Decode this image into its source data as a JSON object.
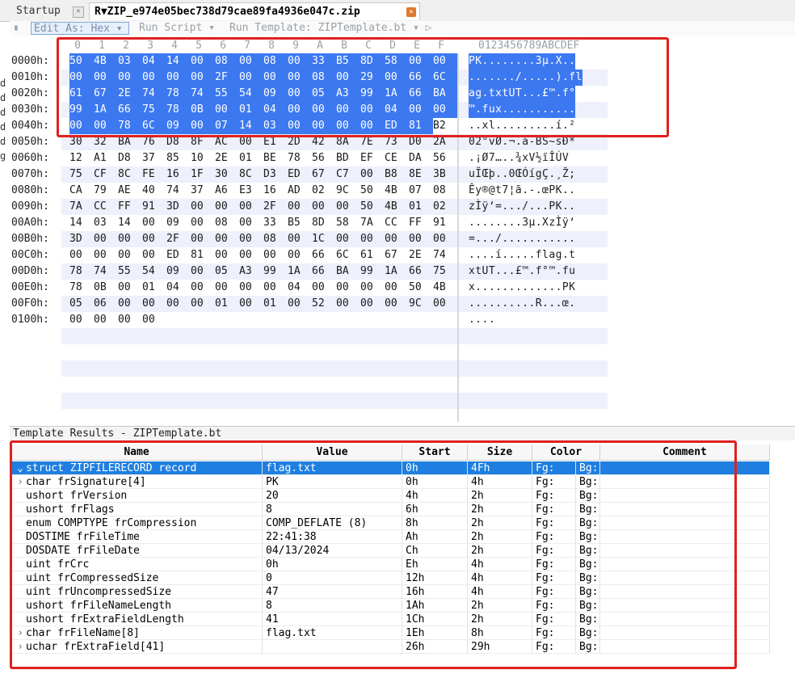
{
  "tabs": {
    "startup": "Startup",
    "file": "R▼ZIP_e974e05bec738d79cae89fa4936e047c.zip"
  },
  "toolbar": {
    "edit_as": "Edit As: Hex ▾",
    "run_script": "Run Script ▾",
    "run_template": "Run Template: ZIPTemplate.bt ▾ ▷"
  },
  "hex": {
    "col_headers": [
      "0",
      "1",
      "2",
      "3",
      "4",
      "5",
      "6",
      "7",
      "8",
      "9",
      "A",
      "B",
      "C",
      "D",
      "E",
      "F"
    ],
    "ascii_header": "0123456789ABCDEF",
    "rows": [
      {
        "addr": "0000h:",
        "bytes": [
          "50",
          "4B",
          "03",
          "04",
          "14",
          "00",
          "08",
          "00",
          "08",
          "00",
          "33",
          "B5",
          "8D",
          "58",
          "00",
          "00"
        ],
        "ascii": "PK........3µ.X.."
      },
      {
        "addr": "0010h:",
        "bytes": [
          "00",
          "00",
          "00",
          "00",
          "00",
          "00",
          "2F",
          "00",
          "00",
          "00",
          "08",
          "00",
          "29",
          "00",
          "66",
          "6C"
        ],
        "ascii": "......./.....).fl"
      },
      {
        "addr": "0020h:",
        "bytes": [
          "61",
          "67",
          "2E",
          "74",
          "78",
          "74",
          "55",
          "54",
          "09",
          "00",
          "05",
          "A3",
          "99",
          "1A",
          "66",
          "BA"
        ],
        "ascii": "ag.txtUT...£™.f°"
      },
      {
        "addr": "0030h:",
        "bytes": [
          "99",
          "1A",
          "66",
          "75",
          "78",
          "0B",
          "00",
          "01",
          "04",
          "00",
          "00",
          "00",
          "00",
          "04",
          "00",
          "00"
        ],
        "ascii": "™.fux..........."
      },
      {
        "addr": "0040h:",
        "bytes": [
          "00",
          "00",
          "78",
          "6C",
          "09",
          "00",
          "07",
          "14",
          "03",
          "00",
          "00",
          "00",
          "00",
          "ED",
          "81",
          "B2"
        ],
        "ascii": "..xl.........í.²"
      },
      {
        "addr": "0050h:",
        "bytes": [
          "30",
          "32",
          "BA",
          "76",
          "D8",
          "8F",
          "AC",
          "00",
          "E1",
          "2D",
          "42",
          "8A",
          "7E",
          "73",
          "D0",
          "2A"
        ],
        "ascii": "02°vØ.¬.á-BS~sÐ*"
      },
      {
        "addr": "0060h:",
        "bytes": [
          "12",
          "A1",
          "D8",
          "37",
          "85",
          "10",
          "2E",
          "01",
          "BE",
          "78",
          "56",
          "BD",
          "EF",
          "CE",
          "DA",
          "56"
        ],
        "ascii": ".¡Ø7…..¾xV½ïÎÚV"
      },
      {
        "addr": "0070h:",
        "bytes": [
          "75",
          "CF",
          "8C",
          "FE",
          "16",
          "1F",
          "30",
          "8C",
          "D3",
          "ED",
          "67",
          "C7",
          "00",
          "B8",
          "8E",
          "3B"
        ],
        "ascii": "uÏŒþ..0ŒÓígÇ.¸Ž;"
      },
      {
        "addr": "0080h:",
        "bytes": [
          "CA",
          "79",
          "AE",
          "40",
          "74",
          "37",
          "A6",
          "E3",
          "16",
          "AD",
          "02",
          "9C",
          "50",
          "4B",
          "07",
          "08"
        ],
        "ascii": "Êy®@t7¦ã.-.œPK.."
      },
      {
        "addr": "0090h:",
        "bytes": [
          "7A",
          "CC",
          "FF",
          "91",
          "3D",
          "00",
          "00",
          "00",
          "2F",
          "00",
          "00",
          "00",
          "50",
          "4B",
          "01",
          "02"
        ],
        "ascii": "zÌÿ‘=.../...PK.."
      },
      {
        "addr": "00A0h:",
        "bytes": [
          "14",
          "03",
          "14",
          "00",
          "09",
          "00",
          "08",
          "00",
          "33",
          "B5",
          "8D",
          "58",
          "7A",
          "CC",
          "FF",
          "91"
        ],
        "ascii": "........3µ.XzÌÿ‘"
      },
      {
        "addr": "00B0h:",
        "bytes": [
          "3D",
          "00",
          "00",
          "00",
          "2F",
          "00",
          "00",
          "00",
          "08",
          "00",
          "1C",
          "00",
          "00",
          "00",
          "00",
          "00"
        ],
        "ascii": "=.../..........."
      },
      {
        "addr": "00C0h:",
        "bytes": [
          "00",
          "00",
          "00",
          "00",
          "ED",
          "81",
          "00",
          "00",
          "00",
          "00",
          "66",
          "6C",
          "61",
          "67",
          "2E",
          "74"
        ],
        "ascii": "....í.....flag.t"
      },
      {
        "addr": "00D0h:",
        "bytes": [
          "78",
          "74",
          "55",
          "54",
          "09",
          "00",
          "05",
          "A3",
          "99",
          "1A",
          "66",
          "BA",
          "99",
          "1A",
          "66",
          "75"
        ],
        "ascii": "xtUT...£™.f°™.fu"
      },
      {
        "addr": "00E0h:",
        "bytes": [
          "78",
          "0B",
          "00",
          "01",
          "04",
          "00",
          "00",
          "00",
          "00",
          "04",
          "00",
          "00",
          "00",
          "00",
          "50",
          "4B"
        ],
        "ascii": "x.............PK"
      },
      {
        "addr": "00F0h:",
        "bytes": [
          "05",
          "06",
          "00",
          "00",
          "00",
          "00",
          "01",
          "00",
          "01",
          "00",
          "52",
          "00",
          "00",
          "00",
          "9C",
          "00"
        ],
        "ascii": "..........R...œ."
      },
      {
        "addr": "0100h:",
        "bytes": [
          "00",
          "00",
          "00",
          "00"
        ],
        "ascii": "...."
      }
    ],
    "selected_byte_count": 79
  },
  "template_results": {
    "title": "Template Results - ZIPTemplate.bt",
    "headers": {
      "name": "Name",
      "value": "Value",
      "start": "Start",
      "size": "Size",
      "color": "Color",
      "comment": "Comment"
    },
    "rows": [
      {
        "caret": "⌄",
        "name": "struct ZIPFILERECORD record",
        "value": "flag.txt",
        "start": "0h",
        "size": "4Fh",
        "fg": "Fg:",
        "bg": "Bg:",
        "selected": true
      },
      {
        "caret": "›",
        "name": "char frSignature[4]",
        "value": "PK",
        "start": "0h",
        "size": "4h",
        "fg": "Fg:",
        "bg": "Bg:"
      },
      {
        "caret": "",
        "name": "ushort frVersion",
        "value": "20",
        "start": "4h",
        "size": "2h",
        "fg": "Fg:",
        "bg": "Bg:"
      },
      {
        "caret": "",
        "name": "ushort frFlags",
        "value": "8",
        "start": "6h",
        "size": "2h",
        "fg": "Fg:",
        "bg": "Bg:"
      },
      {
        "caret": "",
        "name": "enum COMPTYPE frCompression",
        "value": "COMP_DEFLATE (8)",
        "start": "8h",
        "size": "2h",
        "fg": "Fg:",
        "bg": "Bg:"
      },
      {
        "caret": "",
        "name": "DOSTIME frFileTime",
        "value": "22:41:38",
        "start": "Ah",
        "size": "2h",
        "fg": "Fg:",
        "bg": "Bg:"
      },
      {
        "caret": "",
        "name": "DOSDATE frFileDate",
        "value": "04/13/2024",
        "start": "Ch",
        "size": "2h",
        "fg": "Fg:",
        "bg": "Bg:"
      },
      {
        "caret": "",
        "name": "uint frCrc",
        "value": "0h",
        "start": "Eh",
        "size": "4h",
        "fg": "Fg:",
        "bg": "Bg:"
      },
      {
        "caret": "",
        "name": "uint frCompressedSize",
        "value": "0",
        "start": "12h",
        "size": "4h",
        "fg": "Fg:",
        "bg": "Bg:"
      },
      {
        "caret": "",
        "name": "uint frUncompressedSize",
        "value": "47",
        "start": "16h",
        "size": "4h",
        "fg": "Fg:",
        "bg": "Bg:"
      },
      {
        "caret": "",
        "name": "ushort frFileNameLength",
        "value": "8",
        "start": "1Ah",
        "size": "2h",
        "fg": "Fg:",
        "bg": "Bg:"
      },
      {
        "caret": "",
        "name": "ushort frExtraFieldLength",
        "value": "41",
        "start": "1Ch",
        "size": "2h",
        "fg": "Fg:",
        "bg": "Bg:"
      },
      {
        "caret": "›",
        "name": "char frFileName[8]",
        "value": "flag.txt",
        "start": "1Eh",
        "size": "8h",
        "fg": "Fg:",
        "bg": "Bg:"
      },
      {
        "caret": "›",
        "name": "uchar frExtraField[41]",
        "value": "",
        "start": "26h",
        "size": "29h",
        "fg": "Fg:",
        "bg": "Bg:"
      }
    ]
  },
  "left_edge_chars": [
    "d",
    "d",
    "d",
    "d",
    "d",
    "g"
  ],
  "colors": {
    "selection": "#3c78f0",
    "row_selected": "#1e7fe0",
    "annotation": "#e02020"
  }
}
